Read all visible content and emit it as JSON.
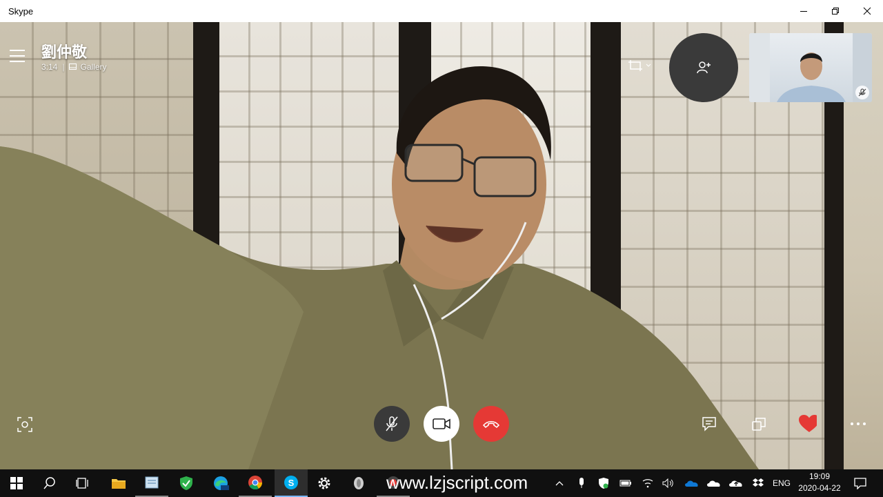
{
  "window": {
    "title": "Skype"
  },
  "call": {
    "caller_name": "劉仲敬",
    "duration": "3:14",
    "separator": "|",
    "view_mode": "Gallery"
  },
  "overlay_icons": {
    "menu": "hamburger-icon",
    "layout": "crop-frame-icon",
    "add_person": "add-person-icon",
    "self_muted": "mic-off-icon",
    "screenshot": "screenshot-icon"
  },
  "controls": {
    "mic": "mic-off-icon",
    "camera": "video-camera-icon",
    "end": "hang-up-icon",
    "chat": "chat-icon",
    "switch": "switch-view-icon",
    "react": "heart-icon",
    "more": "more-icon"
  },
  "colors": {
    "end_call": "#e53935",
    "heart": "#e53935",
    "taskbar": "#101010",
    "active_task": "#7ab8ff"
  },
  "watermark": "www.lzjscript.com",
  "taskbar": {
    "apps": [
      "windows-start-icon",
      "search-icon",
      "task-view-icon",
      "file-explorer-icon",
      "notepad-icon",
      "shield-icon",
      "edge-beta-icon",
      "chrome-icon",
      "skype-icon",
      "settings-icon",
      "app-icon",
      "recorder-icon"
    ],
    "tray": {
      "language": "ENG",
      "time": "19:09",
      "date": "2020-04-22"
    }
  }
}
